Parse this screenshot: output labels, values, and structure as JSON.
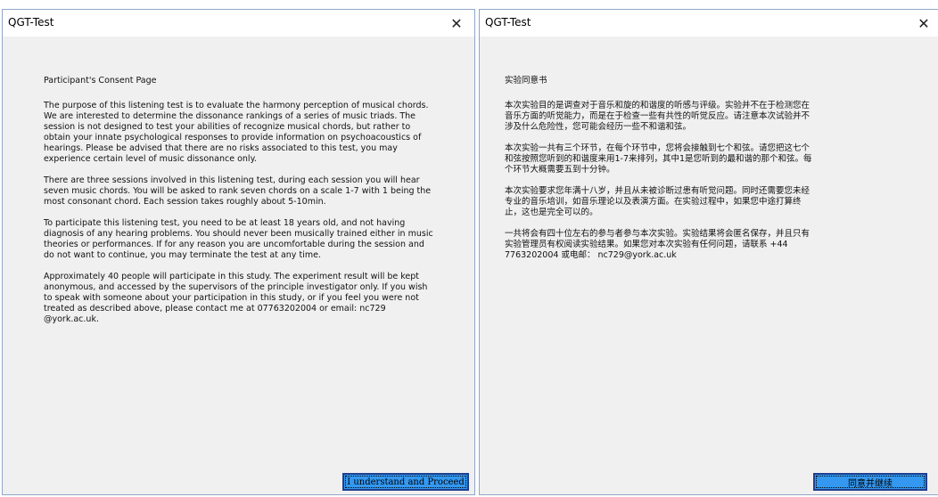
{
  "left_window": {
    "title": "QGT-Test",
    "close_glyph": "✕",
    "heading": "Participant's Consent Page",
    "paragraphs": [
      "The purpose of this listening test is to evaluate the harmony perception of musical chords.\nWe are interested to determine the dissonance rankings of a series of music triads. The\nsession is not designed to test your abilities of recognize musical chords, but rather to\nobtain your innate psychological responses to provide information on psychoacoustics of\nhearings. Please be advised that there are no risks associated to this test, you may\nexperience certain level of music dissonance only.",
      "There are three sessions involved in this listening test, during each session you will hear\nseven music chords. You will be asked to rank seven chords on a scale 1-7 with 1 being the\nmost consonant chord. Each session takes roughly about 5-10min.",
      "To participate this listening test, you need to be at least 18 years old, and not having\ndiagnosis of any hearing problems. You should never been musically trained either in music\ntheories or performances. If for any reason you are uncomfortable during the session and\ndo not want to continue, you may terminate the test at any time.",
      "Approximately 40 people will participate in this study. The experiment result will be kept\nanonymous, and accessed by the supervisors of the principle investigator only. If you wish\nto speak with someone about your participation in this study, or if you feel you were not\ntreated as described above, please contact me at 07763202004 or email: nc729\n@york.ac.uk."
    ],
    "button_label": "I understand and Proceed"
  },
  "right_window": {
    "title": "QGT-Test",
    "close_glyph": "✕",
    "heading": "实验同意书",
    "paragraphs": [
      "本次实验目的是调查对于音乐和旋的和谐度的听感与评级。实验并不在于检测您在\n音乐方面的听觉能力，而是在于检查一些有共性的听觉反应。请注意本次试验并不\n涉及什么危险性，您可能会经历一些不和谐和弦。",
      "本次实验一共有三个环节，在每个环节中，您将会接触到七个和弦。请您把这七个\n和弦按照您听到的和谐度来用1-7来排列，其中1是您听到的最和谐的那个和弦。每\n个环节大概需要五到十分钟。",
      "本次实验要求您年满十八岁，并且从未被诊断过患有听觉问题。同时还需要您未经\n专业的音乐培训，如音乐理论以及表演方面。在实验过程中，如果您中途打算终\n止，这也是完全可以的。",
      "一共将会有四十位左右的参与者参与本次实验。实验结果将会匿名保存，并且只有\n实验管理员有权阅读实验结果。如果您对本次实验有任何问题，请联系     +44\n7763202004 或电邮： nc729@york.ac.uk"
    ],
    "button_label": "同意并继续"
  },
  "colors": {
    "button_fill": "#3498f0",
    "button_border": "#1f3f8f",
    "window_bg": "#f0f0f0",
    "window_border": "#8fa7c9"
  }
}
